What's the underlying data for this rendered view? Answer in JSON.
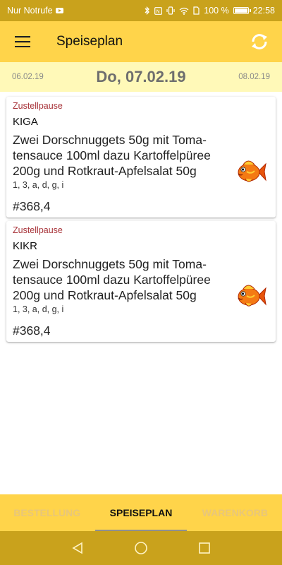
{
  "status_bar": {
    "carrier": "Nur Notrufe",
    "battery": "100 %",
    "time": "22:58"
  },
  "app_bar": {
    "title": "Speiseplan",
    "menu_icon": "hamburger-menu-icon",
    "sync_icon": "sync-icon"
  },
  "date_bar": {
    "prev": "06.02.19",
    "current": "Do, 07.02.19",
    "next": "08.02.19"
  },
  "menu_items": [
    {
      "status": "Zustellpause",
      "code": "KIGA",
      "description": "Zwei Dorschnuggets 50g mit Toma-tensauce 100ml dazu Kartoffelpüree 200g und Rotkraut-Apfelsalat 50g",
      "allergens": "1, 3, a, d, g, i",
      "price": "#368,4",
      "icon": "fish-icon"
    },
    {
      "status": "Zustellpause",
      "code": "KIKR",
      "description": "Zwei Dorschnuggets 50g mit Toma-tensauce 100ml dazu Kartoffelpüree 200g und Rotkraut-Apfelsalat 50g",
      "allergens": "1, 3, a, d, g, i",
      "price": "#368,4",
      "icon": "fish-icon"
    }
  ],
  "tabs": [
    {
      "label": "BESTELLUNG",
      "active": false
    },
    {
      "label": "SPEISEPLAN",
      "active": true
    },
    {
      "label": "WARENKORB",
      "active": false
    }
  ],
  "colors": {
    "app_bar": "#ffd44a",
    "status_bar": "#c9a21c",
    "date_bar": "#fff9b8",
    "status_text": "#a8343a"
  }
}
